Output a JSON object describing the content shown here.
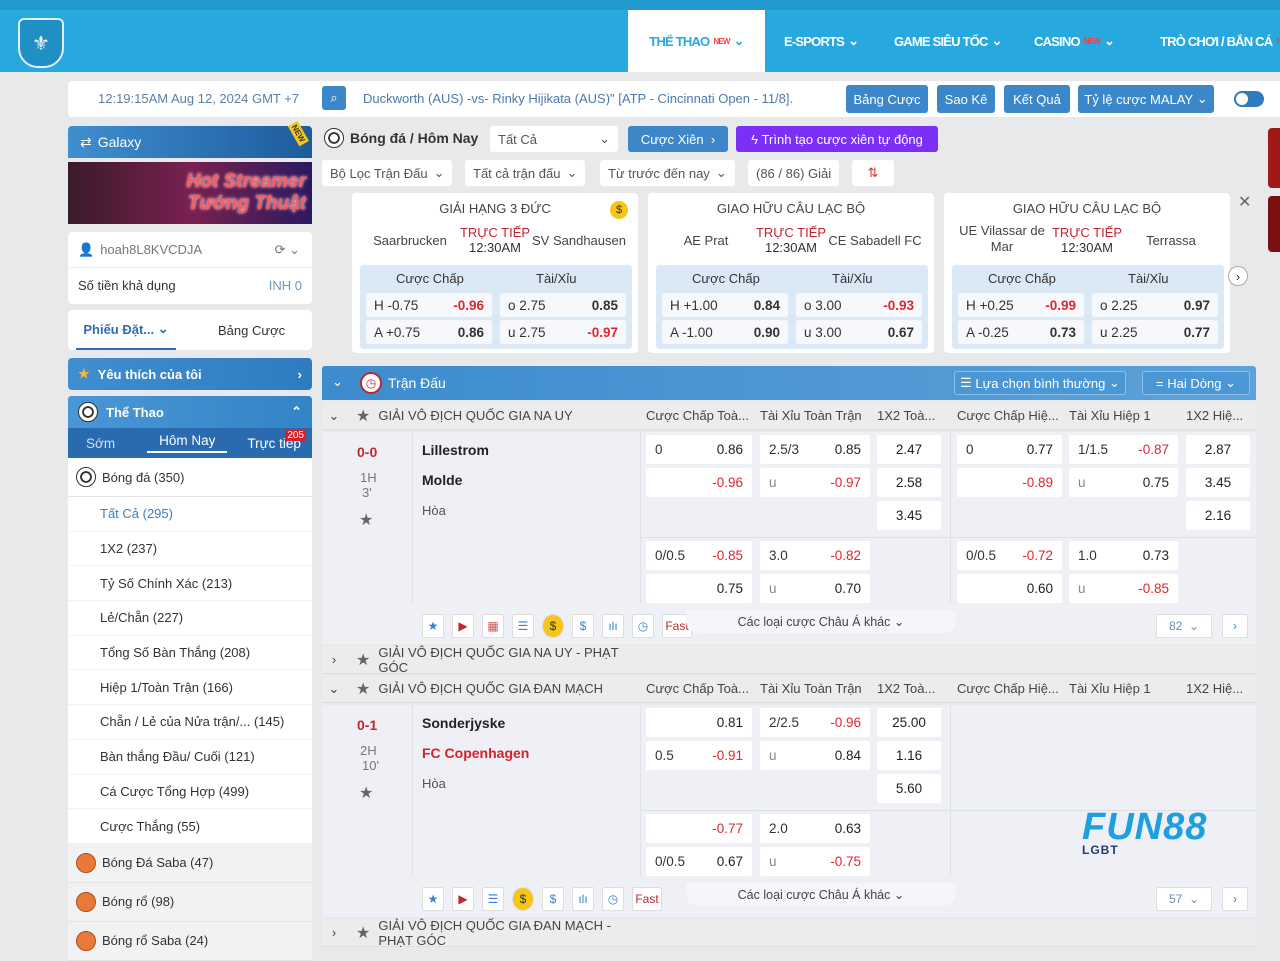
{
  "nav": {
    "items": [
      {
        "label": "THỂ THAO",
        "badge": "NEW",
        "active": true
      },
      {
        "label": "E-SPORTS"
      },
      {
        "label": "GAME SIÊU TỐC"
      },
      {
        "label": "CASINO",
        "badge": "NEW"
      },
      {
        "label": "TRÒ CHƠI / BẮN CÁ",
        "badge": "NE"
      }
    ]
  },
  "infobar": {
    "datetime": "12:19:15AM Aug 12, 2024 GMT +7",
    "ticker": "Duckworth (AUS) -vs- Rinky Hijikata (AUS)\" [ATP - Cincinnati Open - 11/8].",
    "buttons": [
      "Bảng Cược",
      "Sao Kê",
      "Kết Quả",
      "Tỷ lệ cược MALAY"
    ]
  },
  "sidebar": {
    "galaxy": "Galaxy",
    "galaxy_badge": "NEW",
    "banner": "Hot Streamer Tướng Thuật",
    "username": "hoah8L8KVCDJA",
    "balance_label": "Số tiền khả dụng",
    "balance": "INH 0",
    "tabs": [
      "Phiếu Đặt...",
      "Bảng Cược"
    ],
    "favorites": "Yêu thích của tôi",
    "sports_title": "Thể Thao",
    "subtabs": [
      "Sớm",
      "Hôm Nay",
      "Trực tiếp"
    ],
    "live_count": "205",
    "football": "Bóng đá  (350)",
    "items": [
      "Tất Cả (295)",
      "1X2  (237)",
      "Tỷ Số Chính Xác (213)",
      "Lẻ/Chẵn (227)",
      "Tổng Số Bàn Thắng  (208)",
      "Hiệp 1/Toàn Trận  (166)",
      "Chẵn / Lẻ của Nửa trận/...  (145)",
      "Bàn thắng Đầu/ Cuối  (121)",
      "Cá Cược Tổng Hợp  (499)",
      "Cược Thắng  (55)"
    ],
    "sports": [
      "Bóng Đá Saba  (47)",
      "Bóng rổ  (98)",
      "Bóng rổ Saba  (24)"
    ]
  },
  "main": {
    "breadcrumb": "Bóng đá / Hôm Nay",
    "filter_all": "Tất Cả",
    "parlay": "Cược Xiên",
    "auto_parlay": "Trình tạo cược xiên tự động",
    "filters": [
      "Bộ Lọc Trận Đấu",
      "Tất cả trận đấu",
      "Từ trước đến nay"
    ],
    "league_count": "(86 / 86) Giải"
  },
  "featured": [
    {
      "league": "GIẢI HẠNG 3 ĐỨC",
      "home": "Saarbrucken",
      "away": "SV Sandhausen",
      "live": "TRỰC TIẾP",
      "time": "12:30AM",
      "hdp_label": "Cược Chấp",
      "ou_label": "Tài/Xỉu",
      "hdp": [
        [
          "H -0.75",
          "-0.96"
        ],
        [
          "A +0.75",
          "0.86"
        ]
      ],
      "ou": [
        [
          "o 2.75",
          "0.85"
        ],
        [
          "u 2.75",
          "-0.97"
        ]
      ]
    },
    {
      "league": "GIAO HỮU CÂU LẠC BỘ",
      "home": "AE Prat",
      "away": "CE Sabadell FC",
      "live": "TRỰC TIẾP",
      "time": "12:30AM",
      "hdp_label": "Cược Chấp",
      "ou_label": "Tài/Xỉu",
      "hdp": [
        [
          "H +1.00",
          "0.84"
        ],
        [
          "A -1.00",
          "0.90"
        ]
      ],
      "ou": [
        [
          "o 3.00",
          "-0.93"
        ],
        [
          "u 3.00",
          "0.67"
        ]
      ]
    },
    {
      "league": "GIAO HỮU CÂU LẠC BỘ",
      "home": "UE Vilassar de Mar",
      "away": "Terrassa",
      "live": "TRỰC TIẾP",
      "time": "12:30AM",
      "hdp_label": "Cược Chấp",
      "ou_label": "Tài/Xỉu",
      "hdp": [
        [
          "H +0.25",
          "-0.99"
        ],
        [
          "A -0.25",
          "0.73"
        ]
      ],
      "ou": [
        [
          "o 2.25",
          "0.97"
        ],
        [
          "u 2.25",
          "0.77"
        ]
      ]
    }
  ],
  "table": {
    "title": "Trận Đấu",
    "view": "Lựa chọn bình thường",
    "lines": "Hai Dòng",
    "columns": [
      "Cược Chấp Toà...",
      "Tài Xỉu Toàn Trận",
      "1X2 Toà...",
      "Cược Chấp Hiệ...",
      "Tài Xỉu Hiệp 1",
      "1X2 Hiệ..."
    ],
    "more_label": "Các loại cược Châu Á khác",
    "fast": "Fast"
  },
  "leagues": [
    {
      "name": "GIẢI VÔ ĐỊCH QUỐC GIA NA UY",
      "expanded": true,
      "match": {
        "score": "0-0",
        "period": "1H",
        "minute": "3'",
        "home": "Lillestrom",
        "away": "Molde",
        "draw": "Hòa",
        "home_red": false,
        "away_red": false,
        "more_count": "82",
        "main": [
          [
            "0",
            "0.86",
            "2.5/3",
            "0.85",
            "2.47",
            "0",
            "0.77",
            "1/1.5",
            "-0.87",
            "2.87"
          ],
          [
            "",
            "-0.96",
            "u",
            "-0.97",
            "2.58",
            "",
            "-0.89",
            "u",
            "0.75",
            "3.45"
          ],
          [
            "",
            "",
            "",
            "",
            "3.45",
            "",
            "",
            "",
            "",
            "2.16"
          ]
        ],
        "alt": [
          [
            "0/0.5",
            "-0.85",
            "3.0",
            "-0.82",
            "",
            "0/0.5",
            "-0.72",
            "1.0",
            "0.73",
            ""
          ],
          [
            "",
            "0.75",
            "u",
            "0.70",
            "",
            "",
            "0.60",
            "u",
            "-0.85",
            ""
          ]
        ]
      }
    },
    {
      "name": "GIẢI VÔ ĐỊCH QUỐC GIA NA UY - PHẠT GÓC",
      "expanded": false
    },
    {
      "name": "GIẢI VÔ ĐỊCH QUỐC GIA ĐAN MẠCH",
      "expanded": true,
      "match": {
        "score": "0-1",
        "period": "2H",
        "minute": "10'",
        "home": "Sonderjyske",
        "away": "FC Copenhagen",
        "draw": "Hòa",
        "home_red": false,
        "away_red": true,
        "more_count": "57",
        "main": [
          [
            "",
            "0.81",
            "2/2.5",
            "-0.96",
            "25.00",
            "",
            "",
            "",
            "",
            ""
          ],
          [
            "0.5",
            "-0.91",
            "u",
            "0.84",
            "1.16",
            "",
            "",
            "",
            "",
            ""
          ],
          [
            "",
            "",
            "",
            "",
            "5.60",
            "",
            "",
            "",
            "",
            ""
          ]
        ],
        "alt": [
          [
            "",
            "-0.77",
            "2.0",
            "0.63",
            "",
            "",
            "",
            "",
            "",
            ""
          ],
          [
            "0/0.5",
            "0.67",
            "u",
            "-0.75",
            "",
            "",
            "",
            "",
            "",
            ""
          ]
        ]
      }
    },
    {
      "name": "GIẢI VÔ ĐỊCH QUỐC GIA ĐAN MẠCH - PHẠT GÓC",
      "expanded": false
    }
  ],
  "watermark": {
    "brand": "FUN88",
    "sub": "LGBT"
  },
  "colors": {
    "primary": "#27a8df",
    "button": "#3b87c9",
    "negative": "#e0262d",
    "parlay": "#7b2ff7"
  }
}
